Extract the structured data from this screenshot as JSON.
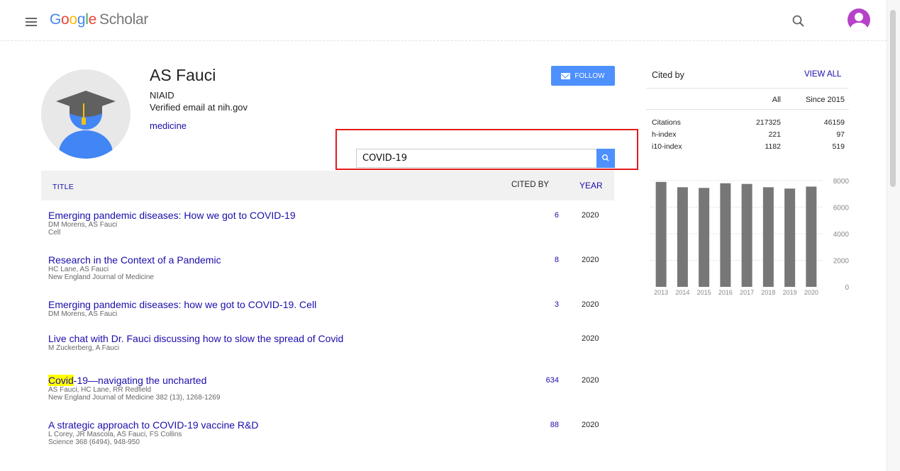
{
  "header": {
    "logo_google": [
      "G",
      "o",
      "o",
      "g",
      "l",
      "e"
    ],
    "logo_scholar": "Scholar"
  },
  "profile": {
    "name": "AS Fauci",
    "affiliation": "NIAID",
    "email": "Verified email at nih.gov",
    "interest": "medicine",
    "follow_label": "FOLLOW"
  },
  "search": {
    "value": "COVID-19"
  },
  "table": {
    "col_title": "TITLE",
    "col_cited": "CITED BY",
    "col_year": "YEAR"
  },
  "articles": [
    {
      "title": "Emerging pandemic diseases: How we got to COVID-19",
      "authors": "DM Morens, AS Fauci",
      "venue": "Cell",
      "cited": "6",
      "year": "2020"
    },
    {
      "title": "Research in the Context of a Pandemic",
      "authors": "HC Lane, AS Fauci",
      "venue": "New England Journal of Medicine",
      "cited": "8",
      "year": "2020"
    },
    {
      "title": "Emerging pandemic diseases: how we got to COVID-19. Cell",
      "authors": "DM Morens, AS Fauci",
      "venue": "",
      "cited": "3",
      "year": "2020"
    },
    {
      "title": "Live chat with Dr. Fauci discussing how to slow the spread of Covid",
      "authors": "M Zuckerberg, A Fauci",
      "venue": "",
      "cited": "",
      "year": "2020"
    },
    {
      "title_highlight": "Covid",
      "title_rest": "-19—navigating the uncharted",
      "authors": "AS Fauci, HC Lane, RR Redfield",
      "venue": "New England Journal of Medicine 382 (13), 1268-1269",
      "cited": "634",
      "year": "2020"
    },
    {
      "title": "A strategic approach to COVID-19 vaccine R&D",
      "authors": "L Corey, JR Mascola, AS Fauci, FS Collins",
      "venue": "Science 368 (6494), 948-950",
      "cited": "88",
      "year": "2020"
    }
  ],
  "cited_by": {
    "title": "Cited by",
    "view_all": "VIEW ALL",
    "col_all": "All",
    "col_since": "Since 2015",
    "rows": [
      {
        "label": "Citations",
        "all": "217325",
        "since": "46159"
      },
      {
        "label": "h-index",
        "all": "221",
        "since": "97"
      },
      {
        "label": "i10-index",
        "all": "1182",
        "since": "519"
      }
    ]
  },
  "chart_data": {
    "type": "bar",
    "categories": [
      "2013",
      "2014",
      "2015",
      "2016",
      "2017",
      "2018",
      "2019",
      "2020"
    ],
    "values": [
      7900,
      7500,
      7450,
      7800,
      7750,
      7500,
      7400,
      7550
    ],
    "ylim": [
      0,
      8000
    ],
    "yticks": [
      "8000",
      "6000",
      "4000",
      "2000",
      "0"
    ],
    "bar_color": "#777777",
    "grid": false
  },
  "colors": {
    "link": "#1a0dab",
    "accent": "#4d90fe",
    "highlight_box": "#e31b1b",
    "avatar": "#b642c9"
  }
}
